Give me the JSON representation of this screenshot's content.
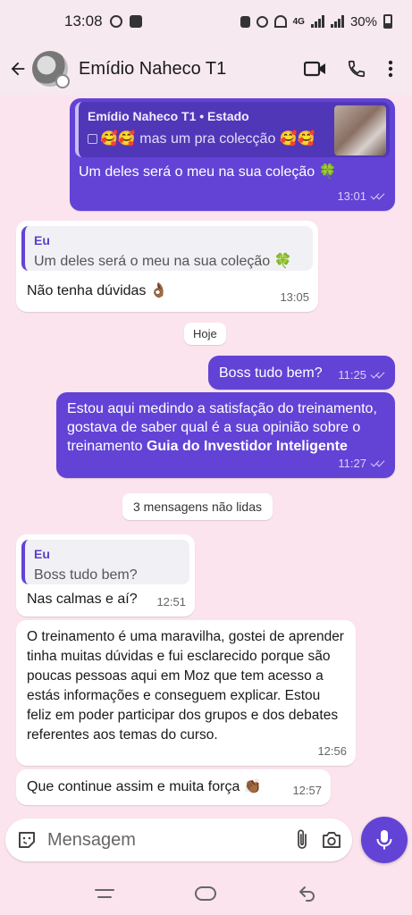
{
  "status_bar": {
    "time": "13:08",
    "battery": "30%",
    "network": "4G"
  },
  "header": {
    "contact_name": "Emídio Naheco T1"
  },
  "messages": {
    "m1": {
      "quote_author": "Emídio Naheco T1 • Estado",
      "quote_text": "🥰🥰 mas um pra colecção 🥰🥰",
      "text": "Um deles será o meu na sua coleção 🍀",
      "time": "13:01"
    },
    "m2": {
      "quote_author": "Eu",
      "quote_text": "Um deles será o meu na sua coleção 🍀",
      "text": "Não tenha dúvidas 👌🏾",
      "time": "13:05"
    },
    "date_divider": "Hoje",
    "m3": {
      "text": "Boss tudo bem?",
      "time": "11:25"
    },
    "m4": {
      "text": "Estou aqui medindo a satisfação do treinamento, gostava de saber qual é a sua opinião sobre o treinamento ",
      "bold": "Guia do Investidor Inteligente",
      "time": "11:27"
    },
    "unread_divider": "3 mensagens não lidas",
    "m5": {
      "quote_author": "Eu",
      "quote_text": "Boss tudo bem?",
      "text": "Nas calmas e aí?",
      "time": "12:51"
    },
    "m6": {
      "text": "O treinamento é uma maravilha, gostei de aprender tinha muitas dúvidas e fui esclarecido porque são poucas pessoas aqui em Moz que tem acesso a estás informações e conseguem explicar. Estou feliz em poder participar dos grupos e dos debates referentes aos temas do curso.",
      "time": "12:56"
    },
    "m7": {
      "text": "Que continue assim e muita força 👏🏾",
      "time": "12:57"
    }
  },
  "input": {
    "placeholder": "Mensagem"
  },
  "colors": {
    "accent": "#6243d6",
    "background": "#fbe4ee",
    "incoming": "#ffffff"
  }
}
